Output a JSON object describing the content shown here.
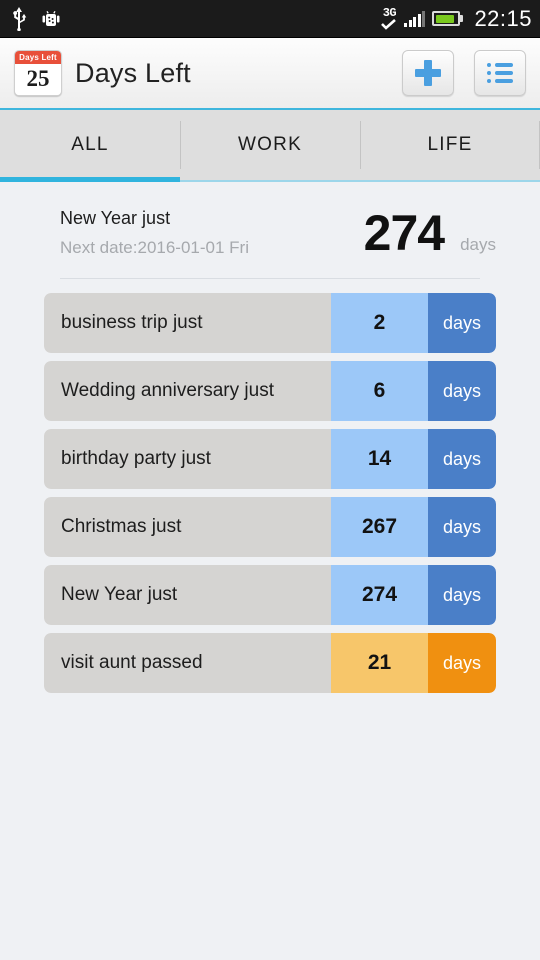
{
  "status_bar": {
    "icons": [
      "usb-icon",
      "android-debug-icon"
    ],
    "network_type": "3G",
    "signal_bars": 4,
    "battery_level_pct": 85,
    "clock": "22:15",
    "background_color": "#1b1b1b"
  },
  "action_bar": {
    "app_icon": {
      "header_text": "Days Left",
      "day_number": "25"
    },
    "title": "Days Left",
    "buttons": [
      {
        "name": "add-event-button",
        "icon": "plus-icon"
      },
      {
        "name": "list-view-button",
        "icon": "list-icon"
      }
    ],
    "accent_color": "#3fb6dd"
  },
  "tabs": {
    "items": [
      {
        "label": "ALL",
        "active": true
      },
      {
        "label": "WORK",
        "active": false
      },
      {
        "label": "LIFE",
        "active": false
      }
    ],
    "indicator_color": "#30b4de"
  },
  "featured": {
    "title": "New Year just",
    "subtitle": "Next date:2016-01-01 Fri",
    "days": "274",
    "unit": "days"
  },
  "events": [
    {
      "name": "business trip just",
      "days": "2",
      "unit": "days",
      "state": "upcoming"
    },
    {
      "name": "Wedding anniversary just",
      "days": "6",
      "unit": "days",
      "state": "upcoming"
    },
    {
      "name": "birthday party just",
      "days": "14",
      "unit": "days",
      "state": "upcoming"
    },
    {
      "name": "Christmas just",
      "days": "267",
      "unit": "days",
      "state": "upcoming"
    },
    {
      "name": "New Year just",
      "days": "274",
      "unit": "days",
      "state": "upcoming"
    },
    {
      "name": "visit aunt passed",
      "days": "21",
      "unit": "days",
      "state": "passed"
    }
  ],
  "colors": {
    "page_background": "#eff1f4",
    "row_label_bg": "#d5d4d2",
    "upcoming_num_bg": "#9cc8f8",
    "upcoming_unit_bg": "#4a7fc8",
    "passed_num_bg": "#f7c66a",
    "passed_unit_bg": "#f09010"
  }
}
